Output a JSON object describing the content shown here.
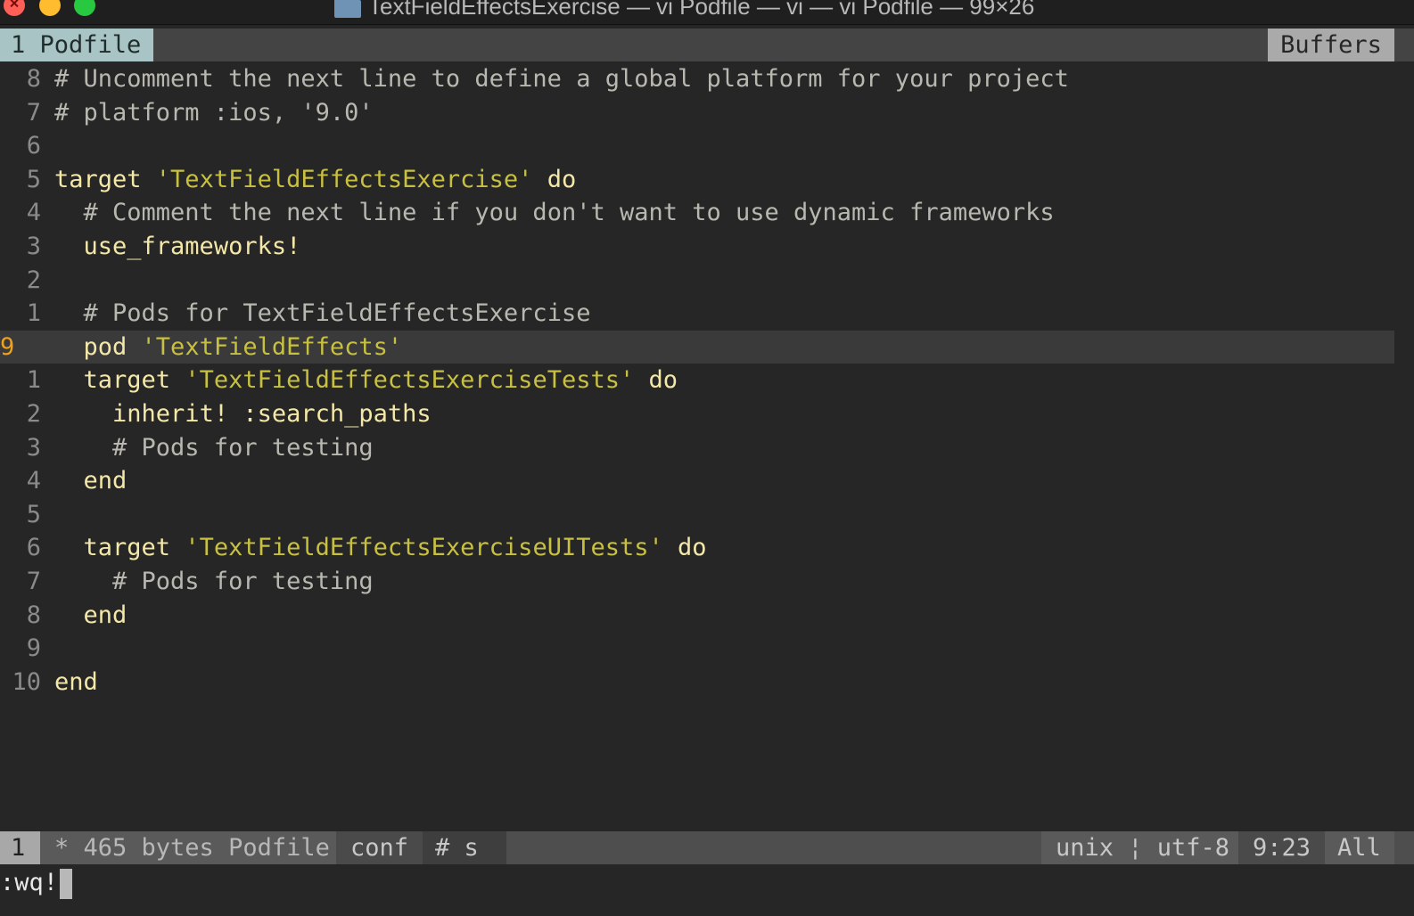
{
  "window": {
    "title": "TextFieldEffectsExercise — vi Podfile — vi — vi Podfile — 99×26",
    "folder_icon": "folder-icon"
  },
  "tabline": {
    "active_tab": "1 Podfile",
    "buffers_label": "Buffers"
  },
  "editor": {
    "lines": [
      {
        "num": "8",
        "tokens": [
          {
            "t": "comment",
            "v": "# Uncomment the next line to define a global platform for your project"
          }
        ]
      },
      {
        "num": "7",
        "tokens": [
          {
            "t": "comment",
            "v": "# platform :ios, '9.0'"
          }
        ]
      },
      {
        "num": "6",
        "tokens": []
      },
      {
        "num": "5",
        "tokens": [
          {
            "t": "kw",
            "v": "target "
          },
          {
            "t": "str",
            "v": "'TextFieldEffectsExercise'"
          },
          {
            "t": "kw",
            "v": " do"
          }
        ]
      },
      {
        "num": "4",
        "tokens": [
          {
            "t": "plain",
            "v": "  "
          },
          {
            "t": "comment",
            "v": "# Comment the next line if you don't want to use dynamic frameworks"
          }
        ]
      },
      {
        "num": "3",
        "tokens": [
          {
            "t": "plain",
            "v": "  "
          },
          {
            "t": "kw",
            "v": "use_frameworks!"
          }
        ]
      },
      {
        "num": "2",
        "tokens": []
      },
      {
        "num": "1",
        "tokens": [
          {
            "t": "plain",
            "v": "  "
          },
          {
            "t": "comment",
            "v": "# Pods for TextFieldEffectsExercise"
          }
        ]
      },
      {
        "num": "9",
        "current": true,
        "tokens": [
          {
            "t": "plain",
            "v": "  "
          },
          {
            "t": "kw",
            "v": "pod "
          },
          {
            "t": "str",
            "v": "'TextFieldEffects'"
          }
        ]
      },
      {
        "num": "1",
        "tokens": [
          {
            "t": "plain",
            "v": "  "
          },
          {
            "t": "kw",
            "v": "target "
          },
          {
            "t": "str",
            "v": "'TextFieldEffectsExerciseTests'"
          },
          {
            "t": "kw",
            "v": " do"
          }
        ]
      },
      {
        "num": "2",
        "tokens": [
          {
            "t": "plain",
            "v": "    "
          },
          {
            "t": "kw",
            "v": "inherit! :search_paths"
          }
        ]
      },
      {
        "num": "3",
        "tokens": [
          {
            "t": "plain",
            "v": "    "
          },
          {
            "t": "comment",
            "v": "# Pods for testing"
          }
        ]
      },
      {
        "num": "4",
        "tokens": [
          {
            "t": "plain",
            "v": "  "
          },
          {
            "t": "kw",
            "v": "end"
          }
        ]
      },
      {
        "num": "5",
        "tokens": []
      },
      {
        "num": "6",
        "tokens": [
          {
            "t": "plain",
            "v": "  "
          },
          {
            "t": "kw",
            "v": "target "
          },
          {
            "t": "str",
            "v": "'TextFieldEffectsExerciseUITests'"
          },
          {
            "t": "kw",
            "v": " do"
          }
        ]
      },
      {
        "num": "7",
        "tokens": [
          {
            "t": "plain",
            "v": "    "
          },
          {
            "t": "comment",
            "v": "# Pods for testing"
          }
        ]
      },
      {
        "num": "8",
        "tokens": [
          {
            "t": "plain",
            "v": "  "
          },
          {
            "t": "kw",
            "v": "end"
          }
        ]
      },
      {
        "num": "9",
        "tokens": []
      },
      {
        "num": "10",
        "tokens": [
          {
            "t": "kw",
            "v": "end"
          }
        ]
      }
    ]
  },
  "statusline": {
    "buffer_number": "1",
    "file_info": "* 465 bytes Podfile",
    "filetype": "conf",
    "tag": "# s",
    "encoding": "unix ¦ utf-8",
    "position": "9:23",
    "percent": "All"
  },
  "cmdline": {
    "text": ":wq!"
  },
  "colors": {
    "background": "#262626",
    "comment": "#b8b8b0",
    "keyword": "#f4e8a8",
    "string": "#c8c040",
    "current_line_number": "#f0a020",
    "active_tab": "#a8c4c4"
  }
}
